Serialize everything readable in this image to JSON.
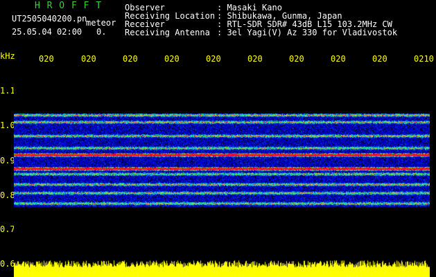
{
  "header": {
    "system_name": "H R O F F T",
    "filename": "UT2505040200.pn",
    "mode": "meteor",
    "date": "25.05.04 02:00",
    "count": "0."
  },
  "info": {
    "observer_label": "Observer",
    "observer_value": ": Masaki Kano",
    "location_label": "Receiving Location",
    "location_value": ": Shibukawa, Gunma, Japan",
    "receiver_label": "Receiver",
    "receiver_value": ": RTL-SDR SDR# 43dB L15 103.2MHz CW",
    "antenna_label": "Receiving Antenna",
    "antenna_value": ": 3el Yagi(V) Az 330 for Vladivostok"
  },
  "axis": {
    "y_unit": "kHz",
    "y_ticks": [
      "1.1",
      "1.0",
      "0.9",
      "0.8",
      "0.7",
      "0.6"
    ],
    "time_ticks": [
      "020",
      "020",
      "020",
      "020",
      "020",
      "020",
      "020",
      "020",
      "020",
      "0210"
    ]
  },
  "colors": {
    "label": "#ffff00",
    "title": "#36d436",
    "text": "#ffffff",
    "bg": "#000000"
  },
  "spectrogram": {
    "freq_range_khz": [
      0.6,
      1.15
    ],
    "bands_khz": [
      1.03,
      1.01,
      0.97,
      0.935,
      0.915,
      0.875,
      0.86,
      0.83,
      0.805,
      0.775
    ],
    "strong_bands_khz": [
      0.915,
      0.875
    ]
  }
}
